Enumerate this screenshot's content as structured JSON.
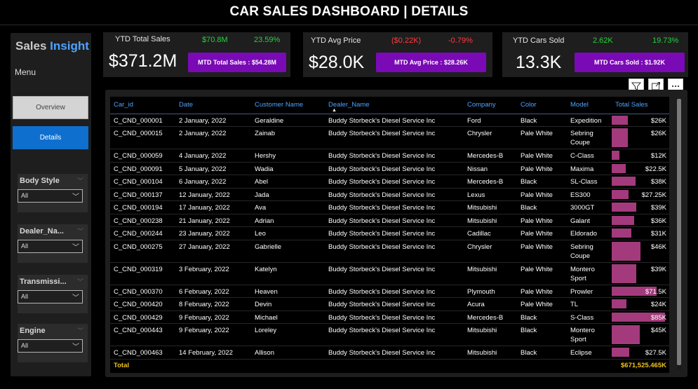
{
  "header": {
    "title": "CAR SALES DASHBOARD | DETAILS"
  },
  "sidebar": {
    "brand_part1": "Sales",
    "brand_part2": "Insight",
    "menu_label": "Menu",
    "nav": [
      {
        "label": "Overview"
      },
      {
        "label": "Details"
      }
    ],
    "slicers": [
      {
        "label": "Body Style",
        "value": "All"
      },
      {
        "label": "Dealer_Na...",
        "value": "All"
      },
      {
        "label": "Transmissi...",
        "value": "All"
      },
      {
        "label": "Engine",
        "value": "All"
      }
    ]
  },
  "kpis": [
    {
      "title": "YTD Total Sales",
      "value": "$371.2M",
      "delta_abs": "$70.8M",
      "delta_pct": "23.59%",
      "mtd": "MTD Total Sales : $54.28M"
    },
    {
      "title": "YTD Avg Price",
      "value": "$28.0K",
      "delta_abs": "($0.22K)",
      "delta_pct": "-0.79%",
      "mtd": "MTD Avg Price : $28.26K"
    },
    {
      "title": "YTD Cars Sold",
      "value": "13.3K",
      "delta_abs": "2.62K",
      "delta_pct": "19.73%",
      "mtd": "MTD Cars Sold : $1.92K"
    }
  ],
  "colors": {
    "accent": "#7a0ab5",
    "nav_active": "#0f6fcf",
    "bar": "#a33a7c",
    "positive": "#27d13c",
    "negative": "#ff3b3b",
    "header_text": "#4ea3ff",
    "total_text": "#f0c419"
  },
  "toolbar": {
    "icons": [
      "filter-icon",
      "focus-mode-icon",
      "more-options-icon"
    ]
  },
  "table": {
    "columns": [
      "Car_id",
      "Date",
      "Customer Name",
      "Dealer_Name",
      "Company",
      "Color",
      "Model",
      "Total Sales"
    ],
    "sorted_column": "Dealer_Name",
    "bar_max": 85,
    "rows": [
      {
        "car_id": "C_CND_000001",
        "date": "2 January, 2022",
        "customer": "Geraldine",
        "dealer": "Buddy Storbeck's Diesel Service Inc",
        "company": "Ford",
        "color": "Black",
        "model": "Expedition",
        "sales": "$26K",
        "sales_k": 26
      },
      {
        "car_id": "C_CND_000015",
        "date": "2 January, 2022",
        "customer": "Zainab",
        "dealer": "Buddy Storbeck's Diesel Service Inc",
        "company": "Chrysler",
        "color": "Pale White",
        "model": "Sebring Coupe",
        "sales": "$26K",
        "sales_k": 26
      },
      {
        "car_id": "C_CND_000059",
        "date": "4 January, 2022",
        "customer": "Hershy",
        "dealer": "Buddy Storbeck's Diesel Service Inc",
        "company": "Mercedes-B",
        "color": "Pale White",
        "model": "C-Class",
        "sales": "$12K",
        "sales_k": 12
      },
      {
        "car_id": "C_CND_000091",
        "date": "5 January, 2022",
        "customer": "Wadia",
        "dealer": "Buddy Storbeck's Diesel Service Inc",
        "company": "Nissan",
        "color": "Pale White",
        "model": "Maxima",
        "sales": "$22.5K",
        "sales_k": 22.5
      },
      {
        "car_id": "C_CND_000104",
        "date": "6 January, 2022",
        "customer": "Abel",
        "dealer": "Buddy Storbeck's Diesel Service Inc",
        "company": "Mercedes-B",
        "color": "Black",
        "model": "SL-Class",
        "sales": "$38K",
        "sales_k": 38
      },
      {
        "car_id": "C_CND_000137",
        "date": "12 January, 2022",
        "customer": "Jada",
        "dealer": "Buddy Storbeck's Diesel Service Inc",
        "company": "Lexus",
        "color": "Pale White",
        "model": "ES300",
        "sales": "$27.25K",
        "sales_k": 27.25
      },
      {
        "car_id": "C_CND_000194",
        "date": "17 January, 2022",
        "customer": "Ava",
        "dealer": "Buddy Storbeck's Diesel Service Inc",
        "company": "Mitsubishi",
        "color": "Black",
        "model": "3000GT",
        "sales": "$39K",
        "sales_k": 39
      },
      {
        "car_id": "C_CND_000238",
        "date": "21 January, 2022",
        "customer": "Adrian",
        "dealer": "Buddy Storbeck's Diesel Service Inc",
        "company": "Mitsubishi",
        "color": "Pale White",
        "model": "Galant",
        "sales": "$36K",
        "sales_k": 36
      },
      {
        "car_id": "C_CND_000244",
        "date": "23 January, 2022",
        "customer": "Leo",
        "dealer": "Buddy Storbeck's Diesel Service Inc",
        "company": "Cadillac",
        "color": "Pale White",
        "model": "Eldorado",
        "sales": "$31K",
        "sales_k": 31
      },
      {
        "car_id": "C_CND_000275",
        "date": "27 January, 2022",
        "customer": "Gabrielle",
        "dealer": "Buddy Storbeck's Diesel Service Inc",
        "company": "Chrysler",
        "color": "Pale White",
        "model": "Sebring Coupe",
        "sales": "$46K",
        "sales_k": 46
      },
      {
        "car_id": "C_CND_000319",
        "date": "3 February, 2022",
        "customer": "Katelyn",
        "dealer": "Buddy Storbeck's Diesel Service Inc",
        "company": "Mitsubishi",
        "color": "Pale White",
        "model": "Montero Sport",
        "sales": "$39K",
        "sales_k": 39
      },
      {
        "car_id": "C_CND_000370",
        "date": "6 February, 2022",
        "customer": "Heaven",
        "dealer": "Buddy Storbeck's Diesel Service Inc",
        "company": "Plymouth",
        "color": "Pale White",
        "model": "Prowler",
        "sales": "$71.5K",
        "sales_k": 71.5
      },
      {
        "car_id": "C_CND_000420",
        "date": "8 February, 2022",
        "customer": "Devin",
        "dealer": "Buddy Storbeck's Diesel Service Inc",
        "company": "Acura",
        "color": "Pale White",
        "model": "TL",
        "sales": "$24K",
        "sales_k": 24
      },
      {
        "car_id": "C_CND_000429",
        "date": "9 February, 2022",
        "customer": "Michael",
        "dealer": "Buddy Storbeck's Diesel Service Inc",
        "company": "Mercedes-B",
        "color": "Black",
        "model": "S-Class",
        "sales": "$85K",
        "sales_k": 85
      },
      {
        "car_id": "C_CND_000443",
        "date": "9 February, 2022",
        "customer": "Loreley",
        "dealer": "Buddy Storbeck's Diesel Service Inc",
        "company": "Mitsubishi",
        "color": "Black",
        "model": "Montero Sport",
        "sales": "$45K",
        "sales_k": 45
      },
      {
        "car_id": "C_CND_000463",
        "date": "14 February, 2022",
        "customer": "Allison",
        "dealer": "Buddy Storbeck's Diesel Service Inc",
        "company": "Mitsubishi",
        "color": "Black",
        "model": "Eclipse",
        "sales": "$27.5K",
        "sales_k": 27.5
      }
    ],
    "total_label": "Total",
    "total_value": "$671,525.465K"
  }
}
